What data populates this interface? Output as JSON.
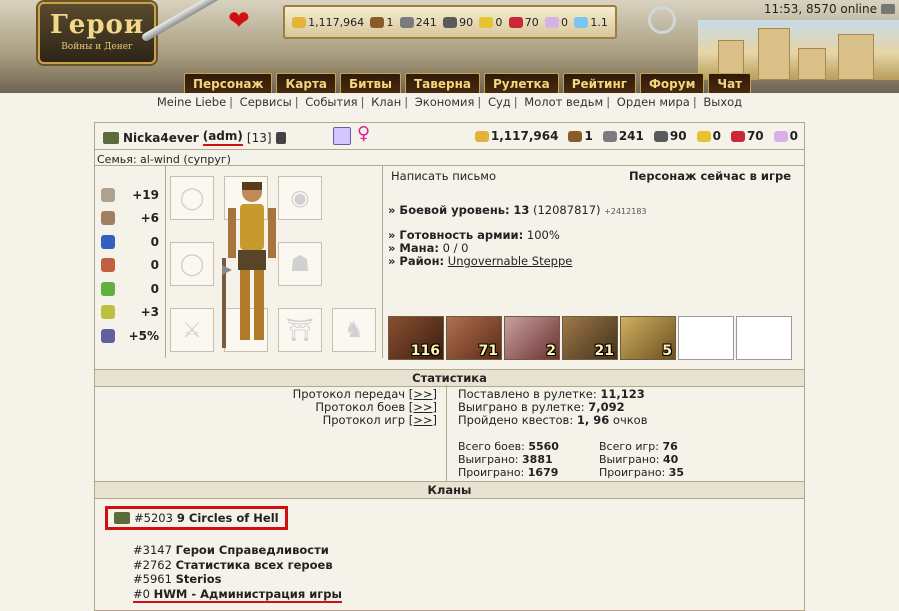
{
  "header": {
    "logo_title": "Герои",
    "logo_subtitle": "Войны и Денег",
    "clock": "11:53, 8570 online",
    "resources": [
      {
        "icon": "gold-icon",
        "value": "1,117,964",
        "color": "#e2b43a"
      },
      {
        "icon": "wood-icon",
        "value": "1",
        "color": "#8a5a2a"
      },
      {
        "icon": "ore-icon",
        "value": "241",
        "color": "#7a7a80"
      },
      {
        "icon": "mercury-icon",
        "value": "90",
        "color": "#5a5a5a"
      },
      {
        "icon": "sulfur-icon",
        "value": "0",
        "color": "#e6c430"
      },
      {
        "icon": "crystals-icon",
        "value": "70",
        "color": "#c8283a"
      },
      {
        "icon": "gems-icon",
        "value": "0",
        "color": "#d8b0e8"
      },
      {
        "icon": "diamonds-icon",
        "value": "1.1",
        "color": "#7ac6f0"
      }
    ]
  },
  "nav": [
    "Персонаж",
    "Карта",
    "Битвы",
    "Таверна",
    "Рулетка",
    "Рейтинг",
    "Форум",
    "Чат"
  ],
  "subnav": [
    "Meine Liebe",
    "Сервисы",
    "События",
    "Клан",
    "Экономия",
    "Суд",
    "Молот ведьм",
    "Орден мира",
    "Выход"
  ],
  "player": {
    "name": "Nicka4ever",
    "tag": "(adm)",
    "level": "[13]",
    "family": "Семья: al-wind (супруг)",
    "resources": [
      {
        "icon": "gold-icon",
        "value": "1,117,964",
        "color": "#e2b43a"
      },
      {
        "icon": "wood-icon",
        "value": "1",
        "color": "#8a5a2a"
      },
      {
        "icon": "ore-icon",
        "value": "241",
        "color": "#7a7a80"
      },
      {
        "icon": "mercury-icon",
        "value": "90",
        "color": "#5a5a5a"
      },
      {
        "icon": "sulfur-icon",
        "value": "0",
        "color": "#e6c430"
      },
      {
        "icon": "crystals-icon",
        "value": "70",
        "color": "#c8283a"
      },
      {
        "icon": "gems-icon",
        "value": "0",
        "color": "#d8b0e8"
      }
    ]
  },
  "stats": [
    {
      "icon": "attack-icon",
      "value": "+19",
      "color": "#b0a090"
    },
    {
      "icon": "defense-icon",
      "value": "+6",
      "color": "#a08060"
    },
    {
      "icon": "spellpower-icon",
      "value": "0",
      "color": "#3060c0"
    },
    {
      "icon": "knowledge-icon",
      "value": "0",
      "color": "#c06040"
    },
    {
      "icon": "luck-icon",
      "value": "0",
      "color": "#60b040"
    },
    {
      "icon": "morale-icon",
      "value": "+3",
      "color": "#c0c040"
    },
    {
      "icon": "initiative-icon",
      "value": "+5%",
      "color": "#6060a0"
    }
  ],
  "info": {
    "write_mail": "Написать письмо",
    "status": "Персонаж сейчас в игре",
    "combat_level_label": "» Боевой уровень:",
    "combat_level": "13",
    "combat_exp": "(12087817)",
    "combat_exp_gain": "+2412183",
    "army_readiness_label": "» Готовность армии:",
    "army_readiness": "100%",
    "mana_label": "» Мана:",
    "mana": "0 / 0",
    "district_label": "» Район:",
    "district": "Ungovernable Steppe"
  },
  "army": [
    "116",
    "71",
    "2",
    "21",
    "5"
  ],
  "statistics": {
    "heading": "Статистика",
    "protocols": [
      {
        "label": "Протокол передач",
        "link": "[>>]"
      },
      {
        "label": "Протокол боев",
        "link": "[>>]"
      },
      {
        "label": "Протокол игр",
        "link": "[>>]"
      }
    ],
    "roulette_bet_label": "Поставлено в рулетке:",
    "roulette_bet": "11,123",
    "roulette_won_label": "Выиграно в рулетке:",
    "roulette_won": "7,092",
    "quests_label": "Пройдено квестов:",
    "quests": "1, 96",
    "quests_unit": "очков",
    "battles_total_label": "Всего боев:",
    "battles_total": "5560",
    "battles_won_label": "Выиграно:",
    "battles_won": "3881",
    "battles_lost_label": "Проиграно:",
    "battles_lost": "1679",
    "games_total_label": "Всего игр:",
    "games_total": "76",
    "games_won_label": "Выиграно:",
    "games_won": "40",
    "games_lost_label": "Проиграно:",
    "games_lost": "35"
  },
  "clans": {
    "heading": "Кланы",
    "main": {
      "id": "#5203",
      "name": "9 Circles of Hell"
    },
    "list": [
      {
        "id": "#3147",
        "name": "Герои Справедливости"
      },
      {
        "id": "#2762",
        "name": "Статистика всех героев"
      },
      {
        "id": "#5961",
        "name": "Sterios"
      },
      {
        "id": "#0",
        "name": "HWM - Администрация игры"
      }
    ]
  }
}
